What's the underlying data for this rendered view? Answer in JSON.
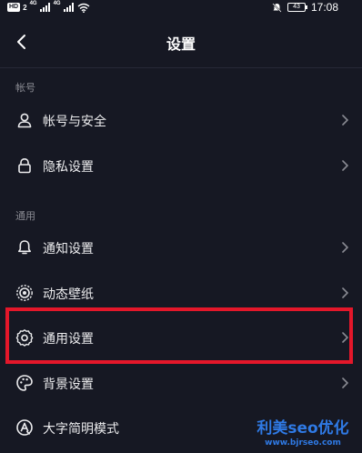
{
  "status_bar": {
    "hd": "HD",
    "sim": "2",
    "net1": "4G",
    "net2": "4G",
    "battery": "43",
    "time": "17:08"
  },
  "nav": {
    "title": "设置"
  },
  "sections": {
    "account": {
      "header": "帐号",
      "items": [
        {
          "label": "帐号与安全",
          "icon": "user-icon"
        },
        {
          "label": "隐私设置",
          "icon": "lock-icon"
        }
      ]
    },
    "general": {
      "header": "通用",
      "items": [
        {
          "label": "通知设置",
          "icon": "bell-icon"
        },
        {
          "label": "动态壁纸",
          "icon": "concentric-circles-icon"
        },
        {
          "label": "通用设置",
          "icon": "gear-icon"
        },
        {
          "label": "背景设置",
          "icon": "palette-icon"
        },
        {
          "label": "大字简明模式",
          "icon": "font-size-icon"
        }
      ]
    }
  },
  "highlight": {
    "color": "#e4172a",
    "target": "通用设置"
  },
  "watermark": {
    "text": "利美seo优化",
    "url": "www.bjrseo.com",
    "color": "#2f7ae5"
  },
  "colors": {
    "background": "#161823",
    "text": "#ececee",
    "muted": "#8a8b93"
  }
}
